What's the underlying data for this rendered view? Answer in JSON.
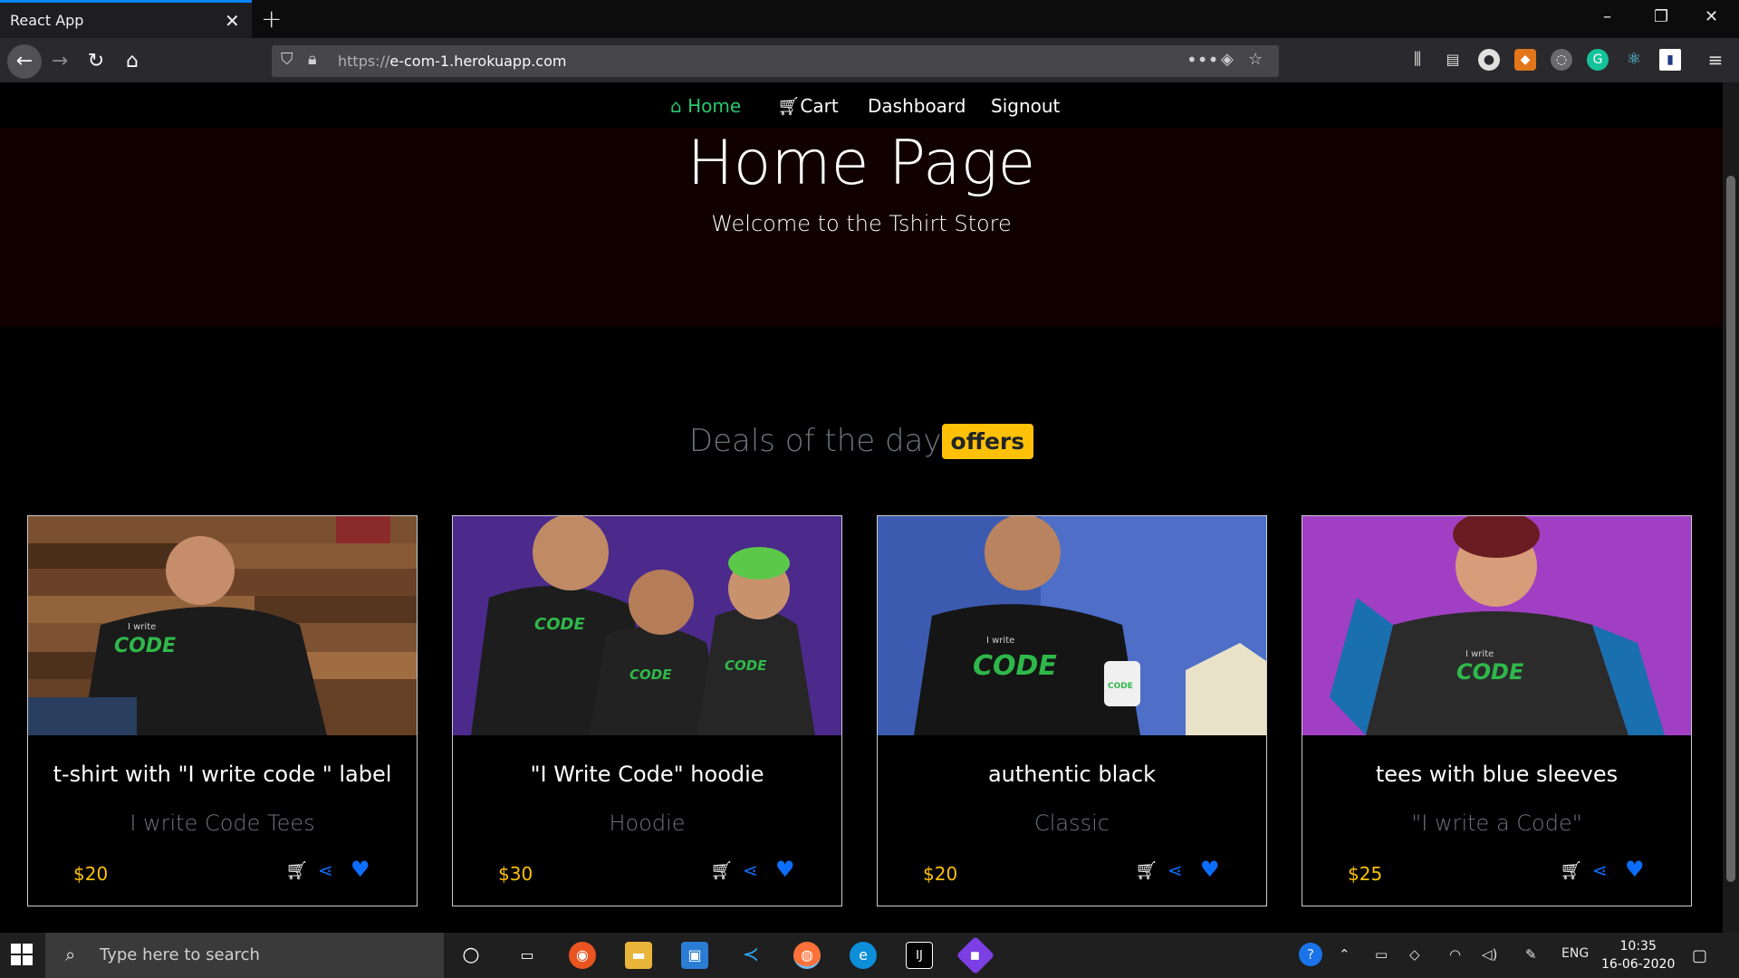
{
  "browser": {
    "tab_title": "React App",
    "tab_close": "✕",
    "new_tab": "+",
    "url_scheme": "https://",
    "url_host": "e-com-1.herokuapp.com",
    "window_controls": [
      "–",
      "❐",
      "✕"
    ]
  },
  "nav": {
    "items": [
      {
        "label": "Home",
        "icon": "home-icon",
        "active": true
      },
      {
        "label": "Cart",
        "icon": "cart-icon",
        "active": false
      },
      {
        "label": "Dashboard",
        "icon": "",
        "active": false
      },
      {
        "label": "Signout",
        "icon": "",
        "active": false
      }
    ]
  },
  "hero": {
    "title": "Home Page",
    "subtitle": "Welcome to the Tshirt Store"
  },
  "deals": {
    "heading": "Deals of the day",
    "badge": "offers"
  },
  "products": [
    {
      "title": "t-shirt with \"I write code \" label",
      "subtitle": "I write Code Tees",
      "price": "$20",
      "image_desc": "man wood wall black tee"
    },
    {
      "title": "\"I Write Code\" hoodie",
      "subtitle": "Hoodie",
      "price": "$30",
      "image_desc": "three people hoodies purple"
    },
    {
      "title": "authentic black",
      "subtitle": "Classic",
      "price": "$20",
      "image_desc": "man blue wall mug"
    },
    {
      "title": "tees with blue sleeves",
      "subtitle": "\"I write a Code\"",
      "price": "$25",
      "image_desc": "woman purple raglan tee"
    }
  ],
  "taskbar": {
    "search_placeholder": "Type here to search",
    "language": "ENG",
    "time": "10:35",
    "date": "16-06-2020"
  },
  "colors": {
    "accent_green": "#28c76f",
    "badge_yellow": "#ffc107",
    "action_blue": "#0d6efd",
    "hero_bg": "#100000"
  }
}
